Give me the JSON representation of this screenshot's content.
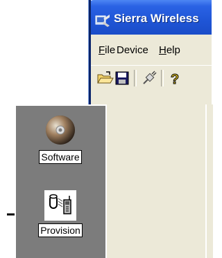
{
  "window": {
    "title": "Sierra Wireless"
  },
  "menu": {
    "file": {
      "u": "F",
      "rest": "ile"
    },
    "device": {
      "pre": "Device"
    },
    "help": {
      "u": "H",
      "rest": "elp"
    }
  },
  "toolbar": {
    "buttons": [
      "open-folder-icon",
      "save-disk-icon",
      "plug-connect-icon",
      "help-question-icon"
    ]
  },
  "nav": {
    "items": [
      {
        "label": "Software",
        "icon": "cd-disc-icon"
      },
      {
        "label": "Provision",
        "icon": "phone-provision-icon"
      }
    ]
  },
  "colors": {
    "titlebar": "#2a62e4",
    "panel": "#7c7c7c",
    "chrome": "#ece9d8",
    "arrow": "#000000"
  }
}
